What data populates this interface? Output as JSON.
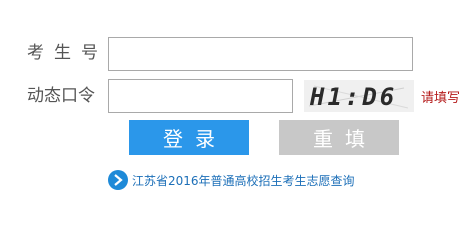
{
  "form": {
    "candidate_number_label": "考生号",
    "candidate_number_value": "",
    "dynamic_code_label": "动态口令",
    "dynamic_code_value": "",
    "captcha_text": "H1:D6",
    "captcha_hint": "请填写"
  },
  "buttons": {
    "login_label": "登录",
    "reset_label": "重填"
  },
  "links": {
    "query_text": "江苏省2016年普通高校招生考生志愿查询"
  },
  "colors": {
    "primary_button": "#2b97ea",
    "secondary_button": "#c8c8c8",
    "hint": "#b51d1d",
    "link": "#1c6fb8"
  },
  "icons": {
    "link_icon": "chevron-right-circle-icon"
  }
}
